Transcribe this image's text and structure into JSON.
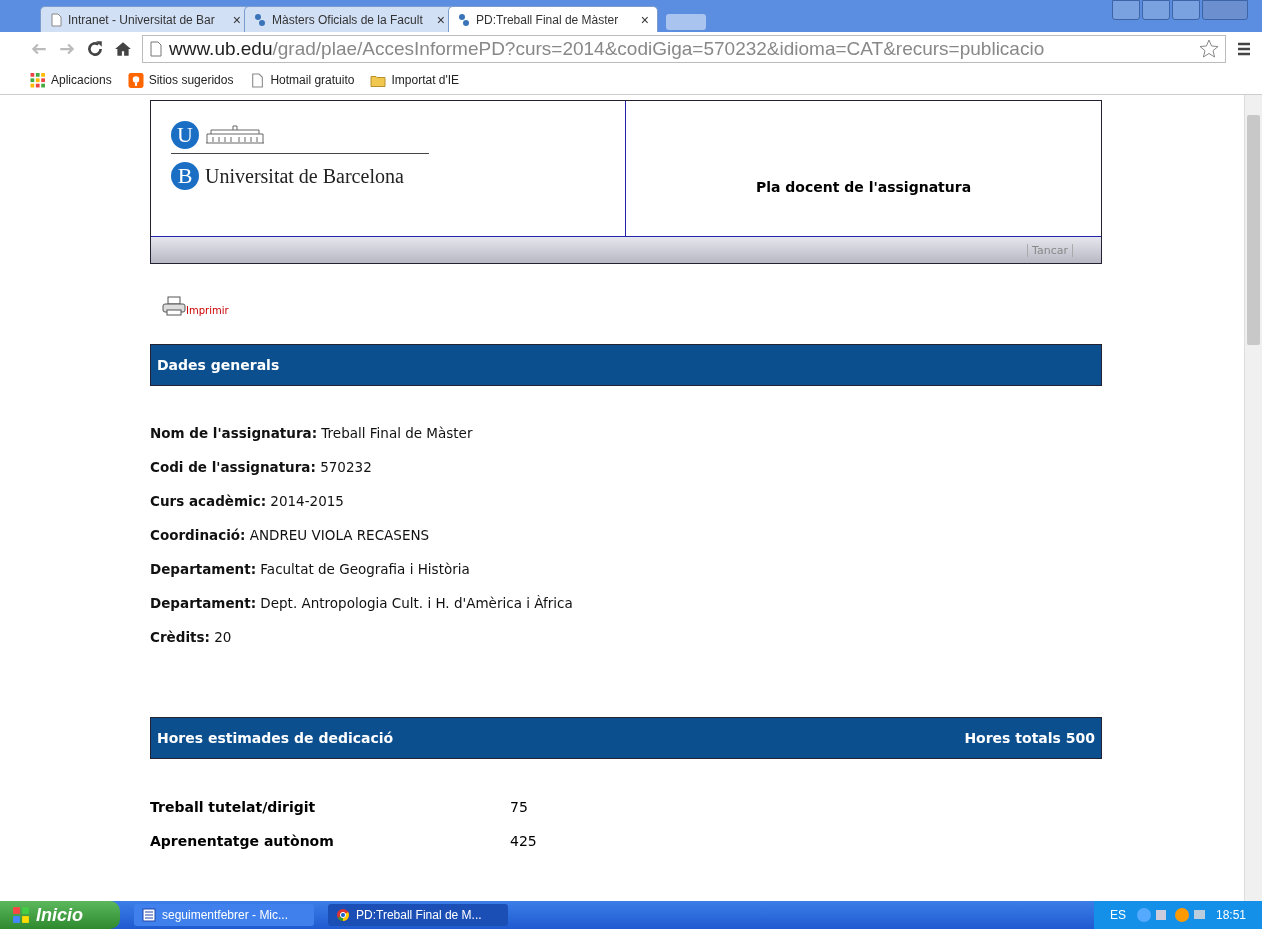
{
  "browser": {
    "tabs": [
      {
        "title": "Intranet - Universitat de Bar",
        "selected": false,
        "kind": "page"
      },
      {
        "title": "Màsters Oficials de la Facult",
        "selected": false,
        "kind": "ub"
      },
      {
        "title": "PD:Treball Final de Màster",
        "selected": true,
        "kind": "ub"
      }
    ],
    "close_glyph": "×",
    "url_host": "www.ub.edu",
    "url_path": "/grad/plae/AccesInformePD?curs=2014&codiGiga=570232&idioma=CAT&recurs=publicacio",
    "bookmarks": [
      {
        "label": "Aplicacions",
        "kind": "apps"
      },
      {
        "label": "Sitios sugeridos",
        "kind": "suggest"
      },
      {
        "label": "Hotmail gratuito",
        "kind": "page"
      },
      {
        "label": "Importat d'IE",
        "kind": "folder"
      }
    ]
  },
  "page": {
    "logo_u": "U",
    "logo_b": "B",
    "university": "Universitat de Barcelona",
    "heading": "Pla docent de l'assignatura",
    "close_link": "Tancar",
    "print_link": "Imprimir",
    "general": {
      "title": "Dades generals",
      "fields": [
        {
          "label": "Nom de l'assignatura:",
          "value": "Treball Final de Màster"
        },
        {
          "label": "Codi de l'assignatura:",
          "value": "570232"
        },
        {
          "label": "Curs acadèmic:",
          "value": "2014-2015"
        },
        {
          "label": "Coordinació:",
          "value": "ANDREU VIOLA RECASENS"
        },
        {
          "label": "Departament:",
          "value": "Facultat de Geografia i Història"
        },
        {
          "label": "Departament:",
          "value": "Dept. Antropologia Cult. i H. d'Amèrica i Àfrica"
        },
        {
          "label": "Crèdits:",
          "value": "20"
        }
      ]
    },
    "hours": {
      "title": "Hores estimades de dedicació",
      "total": "Hores totals 500",
      "rows": [
        {
          "label": "Treball tutelat/dirigit",
          "value": "75"
        },
        {
          "label": "Aprenentatge autònom",
          "value": "425"
        }
      ]
    }
  },
  "taskbar": {
    "start": "Inicio",
    "tasks": [
      {
        "label": "seguimentfebrer - Mic...",
        "kind": "word",
        "selected": false
      },
      {
        "label": "PD:Treball Final de M...",
        "kind": "chrome",
        "selected": true
      }
    ],
    "lang": "ES",
    "clock": "18:51"
  }
}
